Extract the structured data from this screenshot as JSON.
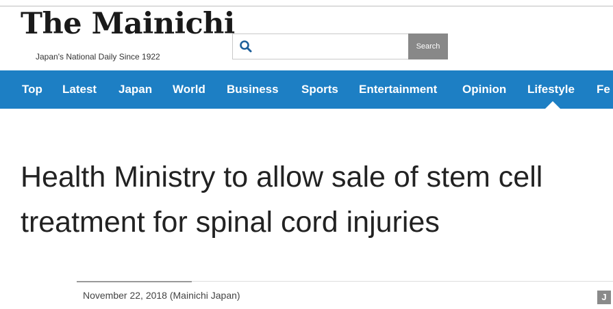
{
  "header": {
    "logo_text": "The Mainichi",
    "tagline": "Japan's National Daily Since 1922"
  },
  "search": {
    "placeholder": "",
    "button_label": "Search"
  },
  "nav": {
    "items": [
      {
        "label": "Top"
      },
      {
        "label": "Latest"
      },
      {
        "label": "Japan"
      },
      {
        "label": "World"
      },
      {
        "label": "Business"
      },
      {
        "label": "Sports"
      },
      {
        "label": "Entertainment"
      },
      {
        "label": "Opinion"
      },
      {
        "label": "Lifestyle"
      },
      {
        "label": "Fe"
      }
    ],
    "active": "Lifestyle"
  },
  "article": {
    "headline_line1": "Health Ministry to allow sale of stem cell",
    "headline_line2": "treatment for spinal cord injuries",
    "dateline": "November 22, 2018 (Mainichi Japan)",
    "share_badge": "J"
  },
  "colors": {
    "nav_background": "#1d7fc4",
    "search_button": "#888888"
  },
  "icons": {
    "search": "search-icon"
  }
}
